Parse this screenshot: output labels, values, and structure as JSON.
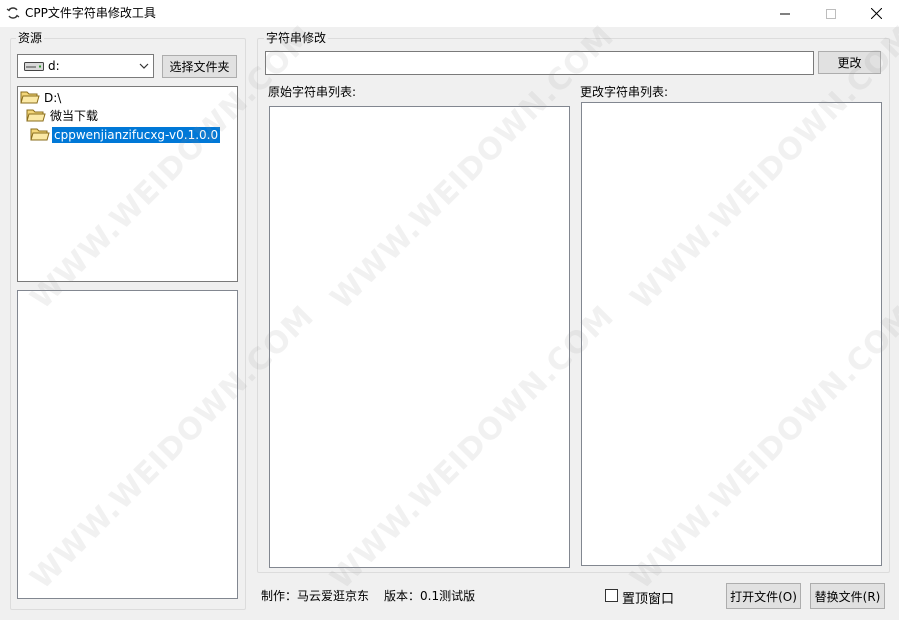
{
  "window": {
    "title": "CPP文件字符串修改工具",
    "min_glyph": "—",
    "max_glyph": "☐",
    "close_glyph": "✕"
  },
  "resources": {
    "group_label": "资源",
    "drive_value": "d:",
    "choose_folder_label": "选择文件夹",
    "tree": [
      {
        "label": "D:\\",
        "depth": 0,
        "selected": false
      },
      {
        "label": "微当下载",
        "depth": 1,
        "selected": false
      },
      {
        "label": "cppwenjianzifucxg-v0.1.0.0",
        "depth": 2,
        "selected": true
      }
    ]
  },
  "editor": {
    "group_label": "字符串修改",
    "input_value": "",
    "change_label": "更改",
    "original_list_label": "原始字符串列表:",
    "modified_list_label": "更改字符串列表:"
  },
  "footer": {
    "author": "制作：马云爱逛京东",
    "version": "版本：0.1测试版",
    "topmost_label": "置顶窗口",
    "topmost_checked": false,
    "open_file_label": "打开文件(O)",
    "replace_file_label": "替换文件(R)"
  },
  "watermark": "WWW.WEIDOWN.COM",
  "colors": {
    "selection": "#0078d7",
    "window_bg": "#f0f0f0"
  }
}
